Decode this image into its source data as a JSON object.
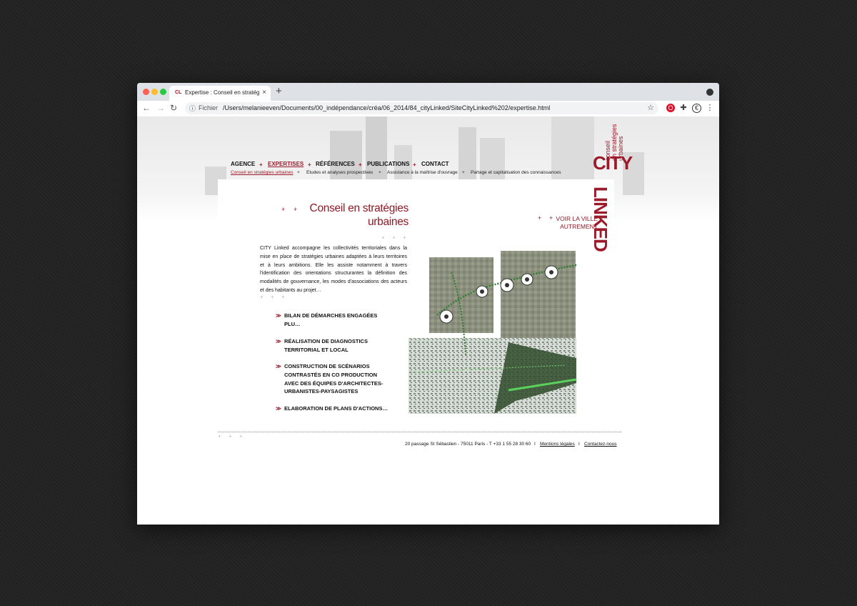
{
  "browser": {
    "tab_icon": "CL",
    "tab_title": "Expertise : Conseil en stratégie",
    "close_symbol": "×",
    "new_tab_symbol": "+",
    "address_label": "Fichier",
    "url": "/Users/melanieeven/Documents/00_indépendance/créa/06_2014/84_cityLinked/SiteCityLinked%202/expertise.html",
    "traffic_colors": [
      "#ff5f57",
      "#febc2e",
      "#28c840"
    ],
    "icons": [
      "back-arrow-icon",
      "forward-arrow-icon",
      "reload-icon",
      "info-icon",
      "star-icon",
      "opera-icon",
      "puzzle-extensions-icon",
      "euro-icon",
      "kebab-menu-icon"
    ]
  },
  "site": {
    "logo_main": "CITY",
    "logo_second": "LINKED",
    "logo_sub": [
      "conseil",
      "en stratégies",
      "urbaines"
    ],
    "brand_color": "#9c1b2a",
    "nav": [
      {
        "label": "AGENCE",
        "active": false
      },
      {
        "label": "EXPERTISES",
        "active": true
      },
      {
        "label": "RÉFÉRENCES",
        "active": false
      },
      {
        "label": "PUBLICATIONS",
        "active": false
      },
      {
        "label": "CONTACT",
        "active": false
      }
    ],
    "plus_sign": "+",
    "subnav": [
      {
        "label": "Conseil en stratégies urbaines",
        "active": true
      },
      {
        "label": "Etudes et analyses prospectives",
        "active": false
      },
      {
        "label": "Assistance à la maîtrise d'ouvrage",
        "active": false
      },
      {
        "label": "Partage et capitalisation des connaissances",
        "active": false
      }
    ]
  },
  "main": {
    "title": "Conseil en stratégies urbaines",
    "voir": "VOIR LA VILLE AUTREMENT",
    "intro": "CITY Linked accompagne les collectivités territoriales dans la mise en place de stratégies urbaines adaptées à leurs territoires et à leurs ambitions. Elle les assiste notamment à travers l'identification des orientations structurantes la définition des modalités de gouvernance, les modes d'associations des acteurs et des habitants au projet…",
    "chevron": "≫",
    "bullets": [
      "BILAN DE DÉMARCHES ENGAGÉES PLU…",
      "RÉALISATION DE DIAGNOSTICS TERRITORIAL ET LOCAL",
      "CONSTRUCTION DE SCÉNARIOS CONTRASTÉS EN CO PRODUCTION AVEC DES ÉQUIPES D'ARCHITECTES-URBANISTES-PAYSAGISTES",
      "ELABORATION DE PLANS D'ACTIONS…"
    ]
  },
  "footer": {
    "address": "20 passage St Sébastien - 75011 Paris - T +33 1 55 28 30 60",
    "separator": "I",
    "legal": "Mentions légales",
    "contact": "Contactez-nous"
  }
}
